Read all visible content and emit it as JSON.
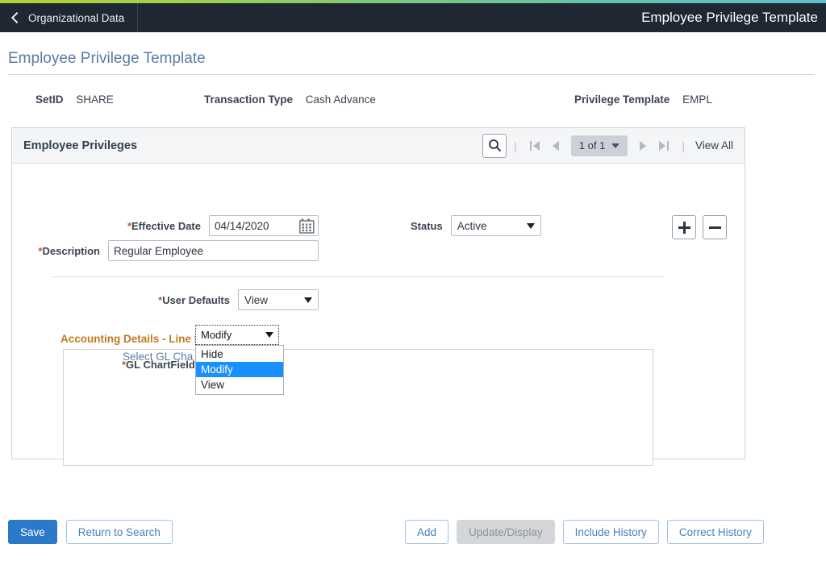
{
  "header": {
    "back_label": "Organizational Data",
    "back_icon": "chevron-left-icon",
    "title": "Employee Privilege Template"
  },
  "page": {
    "title": "Employee Privilege Template"
  },
  "key_info": {
    "setid_label": "SetID",
    "setid_value": "SHARE",
    "transaction_type_label": "Transaction Type",
    "transaction_type_value": "Cash Advance",
    "privilege_template_label": "Privilege Template",
    "privilege_template_value": "EMPL"
  },
  "group_box": {
    "title": "Employee Privileges",
    "nav": {
      "search_icon": "search-icon",
      "separator": "|",
      "first_icon": "first-page-icon",
      "prev_icon": "previous-page-icon",
      "counter": "1 of 1",
      "counter_caret": "chevron-down-icon",
      "next_icon": "next-page-icon",
      "last_icon": "last-page-icon",
      "view_all": "View All"
    }
  },
  "form": {
    "effective_date": {
      "required_marker": "*",
      "label": "Effective Date",
      "value": "04/14/2020",
      "calendar_icon": "calendar-icon"
    },
    "status": {
      "label": "Status",
      "value": "Active",
      "caret_icon": "chevron-down-icon"
    },
    "description": {
      "required_marker": "*",
      "label": "Description",
      "value": "Regular Employee"
    },
    "user_defaults": {
      "required_marker": "*",
      "label": "User Defaults",
      "value": "View",
      "caret_icon": "chevron-down-icon"
    },
    "add_row_icon": "plus-icon",
    "delete_row_icon": "minus-icon"
  },
  "accounting_section": {
    "heading": "Accounting Details - Line Level",
    "gl_chartfields": {
      "required_marker": "*",
      "label": "GL ChartFields",
      "value": "Modify",
      "caret_icon": "chevron-down-icon",
      "expanded": true,
      "options": [
        {
          "label": "Hide",
          "selected": false
        },
        {
          "label": "Modify",
          "selected": true
        },
        {
          "label": "View",
          "selected": false
        }
      ]
    },
    "select_link": "Select GL Cha"
  },
  "footer": {
    "save": "Save",
    "return_to_search": "Return to Search",
    "add": "Add",
    "update_display": "Update/Display",
    "include_history": "Include History",
    "correct_history": "Correct History"
  }
}
